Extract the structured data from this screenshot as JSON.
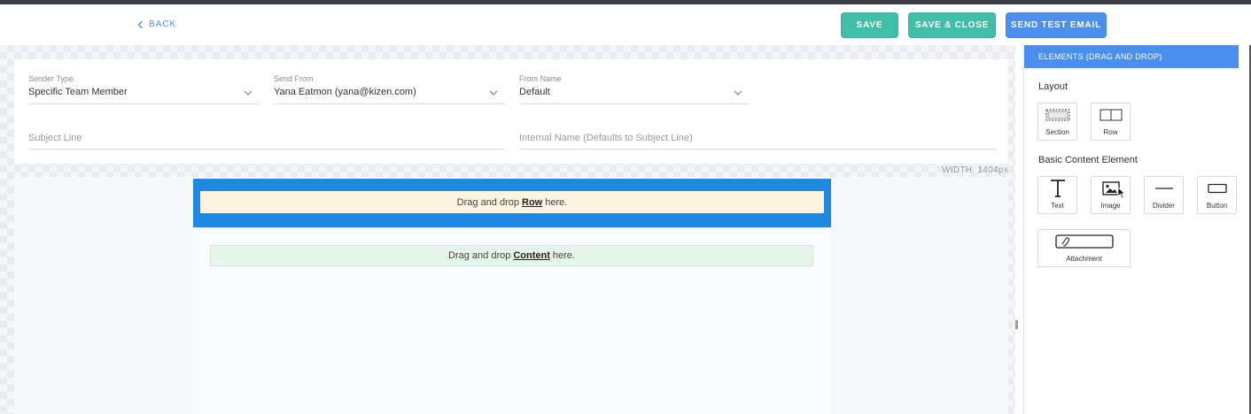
{
  "header": {
    "back_label": "BACK",
    "save_label": "SAVE",
    "save_close_label": "SAVE & CLOSE",
    "send_test_label": "SEND TEST EMAIL"
  },
  "form": {
    "sender_type": {
      "label": "Sender Type",
      "value": "Specific Team Member"
    },
    "send_from": {
      "label": "Send From",
      "value": "Yana Eatmon (yana@kizen.com)"
    },
    "from_name": {
      "label": "From Name",
      "value": "Default"
    },
    "subject_line": {
      "placeholder": "Subject Line"
    },
    "internal_name": {
      "placeholder": "Internal Name (Defaults to Subject Line)"
    }
  },
  "canvas": {
    "width_label": "WIDTH: 1404px",
    "row_drop": {
      "prefix": "Drag and drop",
      "bold": "Row",
      "suffix": "here."
    },
    "content_drop": {
      "prefix": "Drag and drop",
      "bold": "Content",
      "suffix": "here."
    }
  },
  "panel": {
    "title": "ELEMENTS (DRAG AND DROP)",
    "layout_title": "Layout",
    "layout_items": [
      {
        "label": "Section",
        "icon": "section-icon"
      },
      {
        "label": "Row",
        "icon": "row-icon"
      }
    ],
    "basic_title": "Basic Content Element",
    "basic_items": [
      {
        "label": "Text",
        "icon": "text-icon"
      },
      {
        "label": "Image",
        "icon": "image-icon"
      },
      {
        "label": "Divider",
        "icon": "divider-icon"
      },
      {
        "label": "Button",
        "icon": "button-icon"
      },
      {
        "label": "Attachment",
        "icon": "attachment-icon"
      }
    ]
  },
  "colors": {
    "accent_blue": "#4a8ef0",
    "save_green": "#3fbfa8",
    "row_drop_blue": "#1e88e5",
    "row_drop_fill": "#fdf3e1",
    "content_drop_fill": "#e6f5ea"
  }
}
